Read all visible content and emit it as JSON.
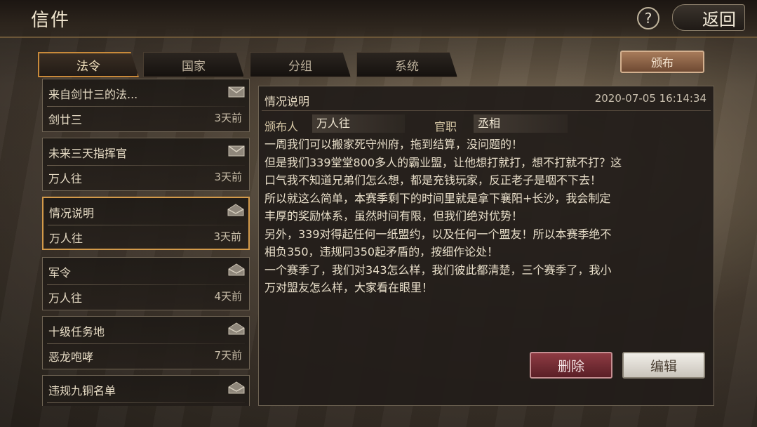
{
  "header": {
    "title": "信件",
    "help_label": "?",
    "back_label": "返回"
  },
  "tabs": [
    {
      "label": "法令",
      "active": true
    },
    {
      "label": "国家",
      "active": false
    },
    {
      "label": "分组",
      "active": false
    },
    {
      "label": "系统",
      "active": false
    }
  ],
  "publish_label": "颁布",
  "messages": [
    {
      "subject": "来自剑廿三的法...",
      "sender": "剑廿三",
      "time": "3天前",
      "selected": false
    },
    {
      "subject": "未来三天指挥官",
      "sender": "万人往",
      "time": "3天前",
      "selected": false
    },
    {
      "subject": "情况说明",
      "sender": "万人往",
      "time": "3天前",
      "selected": true
    },
    {
      "subject": "军令",
      "sender": "万人往",
      "time": "4天前",
      "selected": false
    },
    {
      "subject": "十级任务地",
      "sender": "恶龙咆哮",
      "time": "7天前",
      "selected": false
    },
    {
      "subject": "违规九铜名单",
      "sender": "",
      "time": "",
      "selected": false
    }
  ],
  "detail": {
    "title": "情况说明",
    "date": "2020-07-05 16:14:34",
    "publisher_label": "颁布人",
    "publisher_name": "万人往",
    "office_label": "官职",
    "office_value": "丞相",
    "body_lines": [
      "一周我们可以搬家死守州府，拖到结算，没问题的！",
      "但是我们339堂堂800多人的霸业盟，让他想打就打，想不打就不打？这",
      "口气我不知道兄弟们怎么想，都是充钱玩家，反正老子是咽不下去！",
      "所以就这么简单，本赛季剩下的时间里就是拿下襄阳+长沙，我会制定",
      "丰厚的奖励体系，虽然时间有限，但我们绝对优势！",
      "另外，339对得起任何一纸盟约，以及任何一个盟友！所以本赛季绝不",
      "相负350，违规同350起矛盾的，按细作论处！",
      "一个赛季了，我们对343怎么样，我们彼此都清楚，三个赛季了，我小",
      "万对盟友怎么样，大家看在眼里！"
    ],
    "delete_label": "删除",
    "edit_label": "编辑"
  }
}
